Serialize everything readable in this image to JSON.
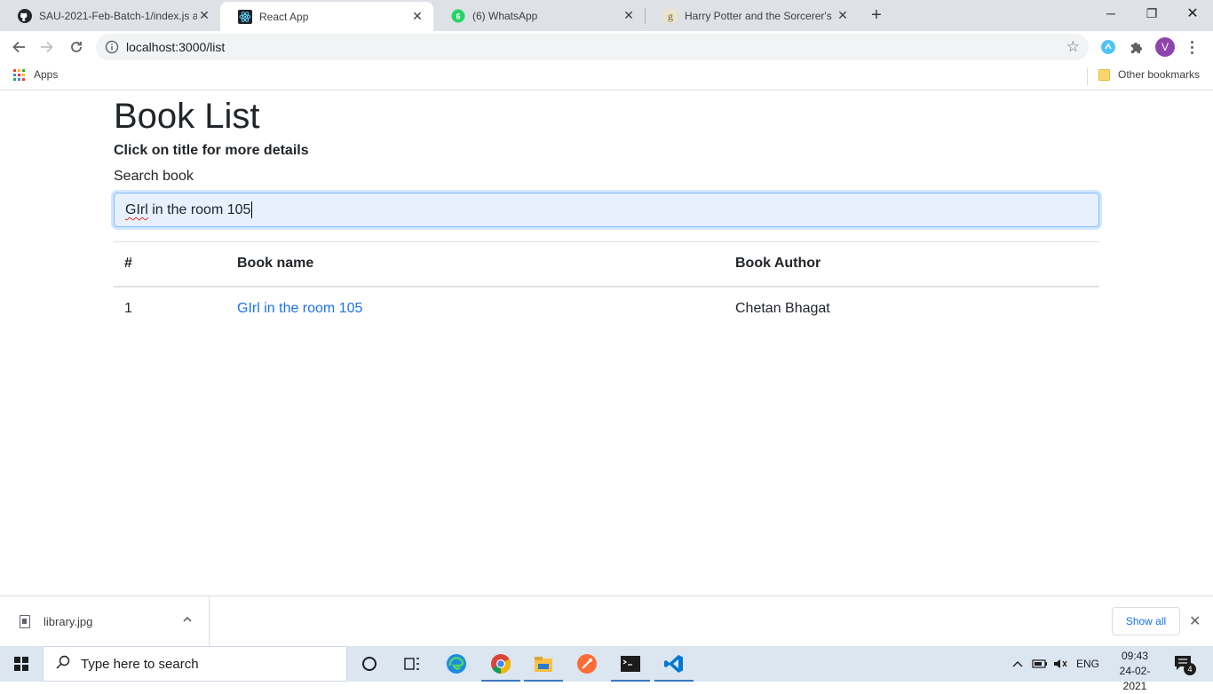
{
  "browser": {
    "tabs": [
      {
        "title": "SAU-2021-Feb-Batch-1/index.js a",
        "icon": "github-icon"
      },
      {
        "title": "React App",
        "icon": "react-icon"
      },
      {
        "title": "(6) WhatsApp",
        "icon": "whatsapp-icon"
      },
      {
        "title": "Harry Potter and the Sorcerer's St",
        "icon": "goodreads-icon"
      }
    ],
    "url": "localhost:3000/list",
    "bookmarks": {
      "apps_label": "Apps",
      "other_label": "Other bookmarks"
    },
    "profile_initial": "V"
  },
  "page": {
    "title": "Book List",
    "subtitle": "Click on title for more details",
    "search_label": "Search book",
    "search_value_first": "GIrl",
    "search_value_rest": " in the room 105",
    "table": {
      "headers": [
        "#",
        "Book name",
        "Book Author"
      ],
      "rows": [
        {
          "num": "1",
          "name": "GIrl in the room 105",
          "author": "Chetan Bhagat"
        }
      ]
    }
  },
  "downloads": {
    "file_name": "library.jpg",
    "show_all_label": "Show all"
  },
  "taskbar": {
    "search_placeholder": "Type here to search",
    "language": "ENG",
    "time": "09:43",
    "date": "24-02-2021",
    "notification_count": "4"
  },
  "colors": {
    "link": "#1a73e8",
    "search_focus_border": "#80bdff",
    "tabstrip_bg": "#dee1e6"
  }
}
